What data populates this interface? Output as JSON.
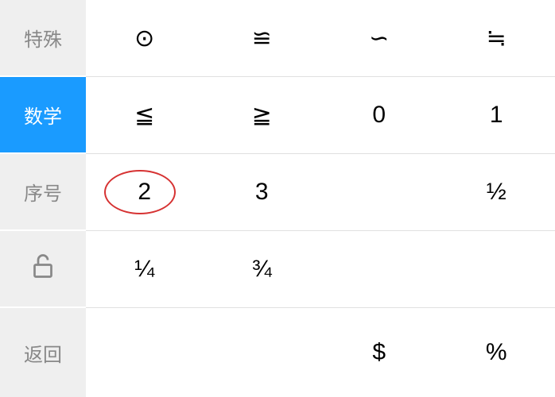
{
  "sidebar": {
    "items": [
      {
        "label": "特殊",
        "active": false,
        "type": "text"
      },
      {
        "label": "数学",
        "active": true,
        "type": "text"
      },
      {
        "label": "序号",
        "active": false,
        "type": "text"
      },
      {
        "label": "",
        "active": false,
        "type": "lock-icon"
      },
      {
        "label": "返回",
        "active": false,
        "type": "text"
      }
    ]
  },
  "grid": {
    "rows": [
      {
        "cells": [
          "⊙",
          "≌",
          "∽",
          "≒"
        ]
      },
      {
        "cells": [
          "≦",
          "≧",
          "0",
          "1"
        ]
      },
      {
        "cells": [
          "2",
          "3",
          "",
          "½"
        ],
        "highlight": 0
      },
      {
        "cells": [
          "¼",
          "¾",
          "",
          ""
        ]
      },
      {
        "cells": [
          "",
          "",
          "$",
          "%"
        ]
      }
    ]
  },
  "colors": {
    "active_bg": "#1a9bff",
    "inactive_bg": "#efefef",
    "active_text": "#ffffff",
    "inactive_text": "#888888",
    "highlight_border": "#d63232",
    "grid_border": "#e0e0e0"
  }
}
